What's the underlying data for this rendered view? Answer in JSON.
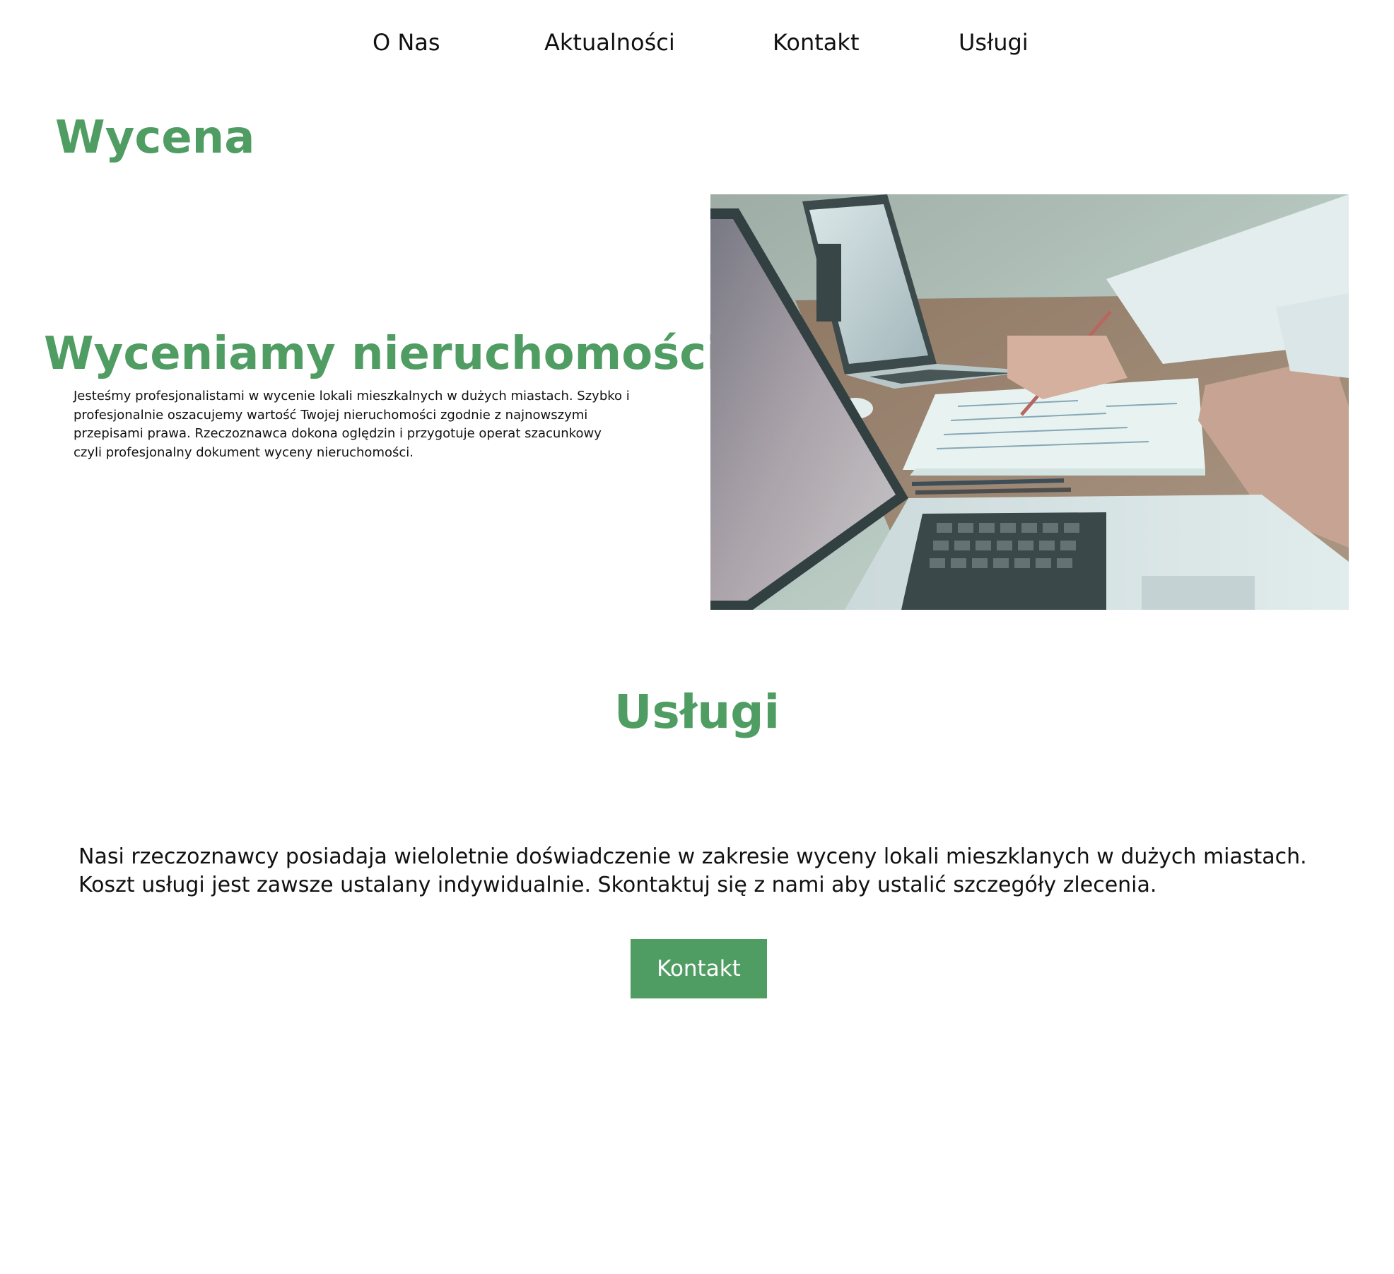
{
  "nav": {
    "items": [
      {
        "label": "O Nas"
      },
      {
        "label": "Aktualności"
      },
      {
        "label": "Kontakt"
      },
      {
        "label": "Usługi"
      }
    ]
  },
  "page_title": "Wycena",
  "hero": {
    "title": "Wyceniamy nieruchomości",
    "description": "Jesteśmy profesjonalistami w wycenie  lokali mieszkalnych w dużych miastach. Szybko i profesjonalnie oszacujemy wartość Twojej nieruchomości zgodnie z najnowszymi przepisami prawa. Rzeczoznawca dokona oględzin i przygotuje operat szacunkowy czyli profesjonalny dokument wyceny nieruchomości."
  },
  "services": {
    "title": "Usługi",
    "description_line1": "Nasi rzeczoznawcy posiadaja wieloletnie doświadczenie w zakresie wyceny lokali mieszklanych w dużych miastach.",
    "description_line2": "Koszt usługi jest zawsze ustalany indywidualnie. Skontaktuj się z nami aby ustalić szczegóły zlecenia.",
    "button_label": "Kontakt"
  },
  "colors": {
    "accent": "#4f9d62",
    "text": "#111111",
    "background": "#ffffff"
  }
}
